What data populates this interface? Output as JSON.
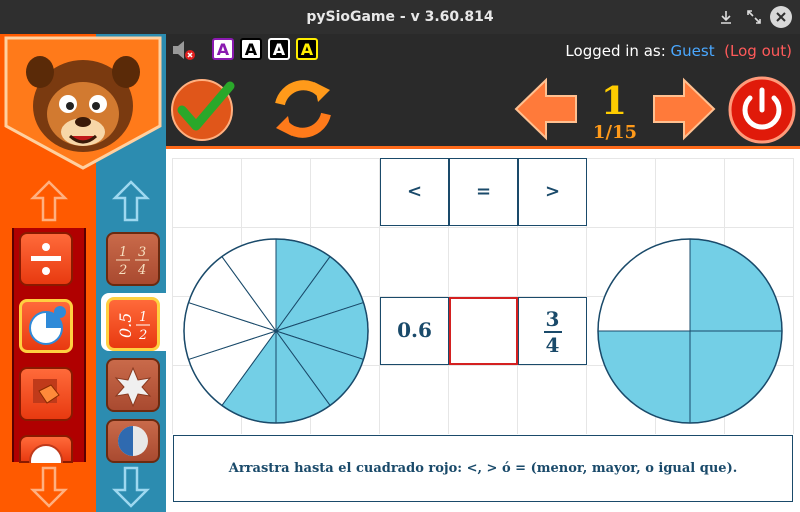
{
  "window": {
    "title": "pySioGame - v 3.60.814"
  },
  "topbar": {
    "font_options": [
      "A",
      "A",
      "A",
      "A"
    ],
    "login_prefix": "Logged in as:",
    "user": "Guest",
    "logout": "(Log out)"
  },
  "navigation": {
    "page": "1",
    "total": "1/15"
  },
  "game": {
    "operators": [
      "<",
      "=",
      ">"
    ],
    "left_value": "0.6",
    "right_fraction": {
      "numerator": "3",
      "denominator": "4"
    },
    "answer": "",
    "left_circle": {
      "slices": 10,
      "shaded": 6
    },
    "right_circle": {
      "slices": 4,
      "shaded": 3
    }
  },
  "instruction": "Arrastra hasta el cuadrado rojo: <, > ó = (menor, mayor, o igual que).",
  "colors": {
    "accent": "#ff5a00",
    "fill": "#73cfe6",
    "ink": "#1a4a6a",
    "target": "#d42020"
  }
}
